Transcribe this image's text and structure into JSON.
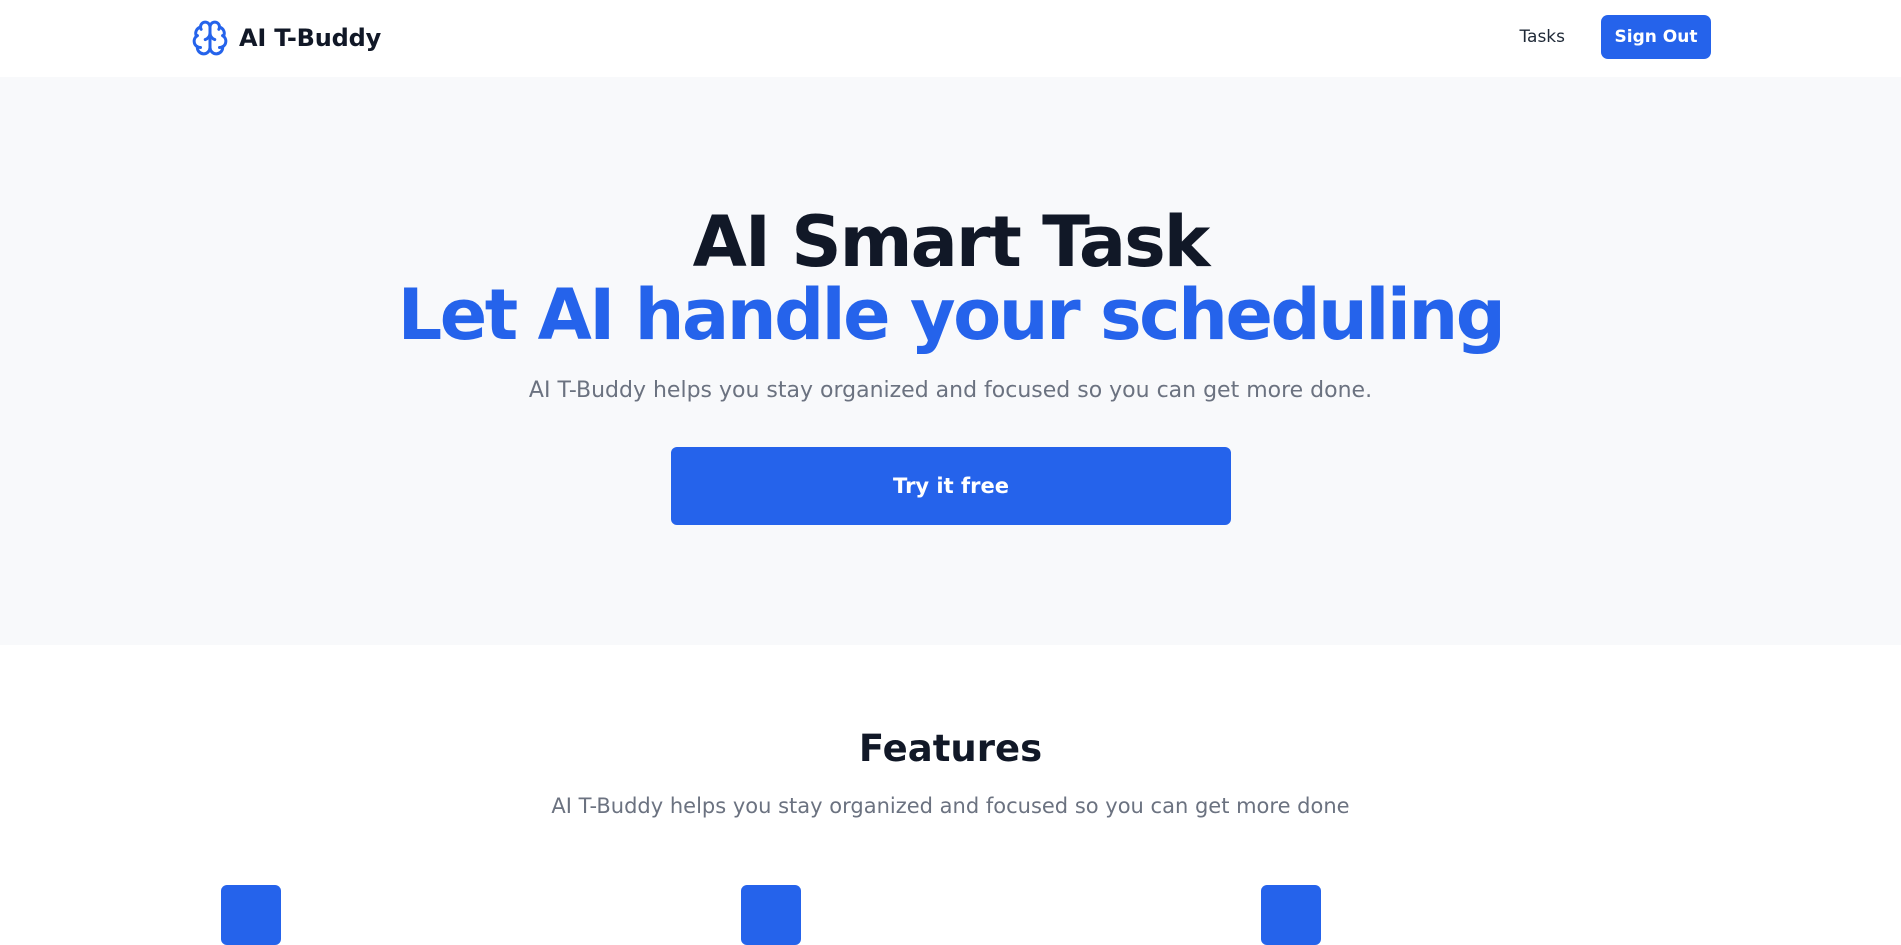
{
  "navbar": {
    "brand_name": "AI T-Buddy",
    "brand_icon": "brain-icon",
    "links": {
      "tasks": "Tasks"
    },
    "sign_out_label": "Sign Out"
  },
  "hero": {
    "title": "AI Smart Task",
    "subtitle": "Let AI handle your scheduling",
    "description": "AI T-Buddy helps you stay organized and focused so you can get more done.",
    "cta_label": "Try it free"
  },
  "features": {
    "title": "Features",
    "description": "AI T-Buddy helps you stay organized and focused so you can get more done"
  },
  "colors": {
    "accent": "#2563eb",
    "heading": "#111827",
    "muted": "#6b7280",
    "hero_bg": "#f8f9fb"
  }
}
